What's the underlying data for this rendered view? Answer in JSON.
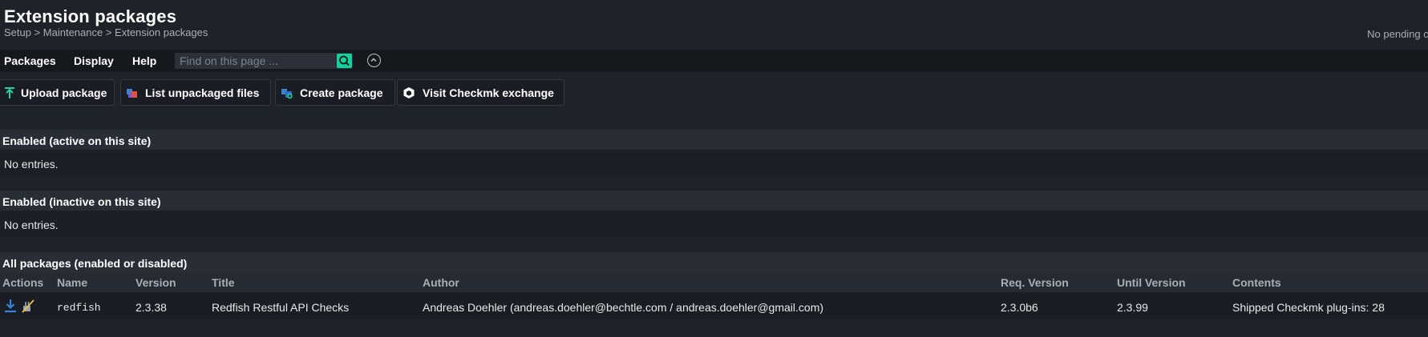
{
  "header": {
    "title": "Extension packages",
    "breadcrumb": "Setup > Maintenance > Extension packages",
    "pending": "No pending ch"
  },
  "menubar": {
    "items": [
      "Packages",
      "Display",
      "Help"
    ],
    "search_placeholder": "Find on this page ..."
  },
  "toolbar": {
    "buttons": [
      {
        "label": "Upload package",
        "icon": "upload-icon"
      },
      {
        "label": "List unpackaged files",
        "icon": "unpackaged-files-icon"
      },
      {
        "label": "Create package",
        "icon": "create-package-icon"
      },
      {
        "label": "Visit Checkmk exchange",
        "icon": "exchange-icon"
      }
    ]
  },
  "sections": {
    "enabled_active": {
      "title": "Enabled (active on this site)",
      "body": "No entries."
    },
    "enabled_inactive": {
      "title": "Enabled (inactive on this site)",
      "body": "No entries."
    },
    "all_packages": {
      "title": "All packages (enabled or disabled)"
    }
  },
  "table": {
    "headers": [
      "Actions",
      "Name",
      "Version",
      "Title",
      "Author",
      "Req. Version",
      "Until Version",
      "Contents"
    ],
    "rows": [
      {
        "actions": [
          "download-icon",
          "disable-icon"
        ],
        "name": "redfish",
        "version": "2.3.38",
        "title": "Redfish Restful API Checks",
        "author": "Andreas Doehler (andreas.doehler@bechtle.com / andreas.doehler@gmail.com)",
        "req_version": "2.3.0b6",
        "until_version": "2.3.99",
        "contents": "Shipped Checkmk plug-ins: 28"
      }
    ]
  },
  "colors": {
    "background": "#1e2229",
    "menubar": "#15181d",
    "section_header": "#292e36",
    "accent_green": "#15d1a0"
  }
}
